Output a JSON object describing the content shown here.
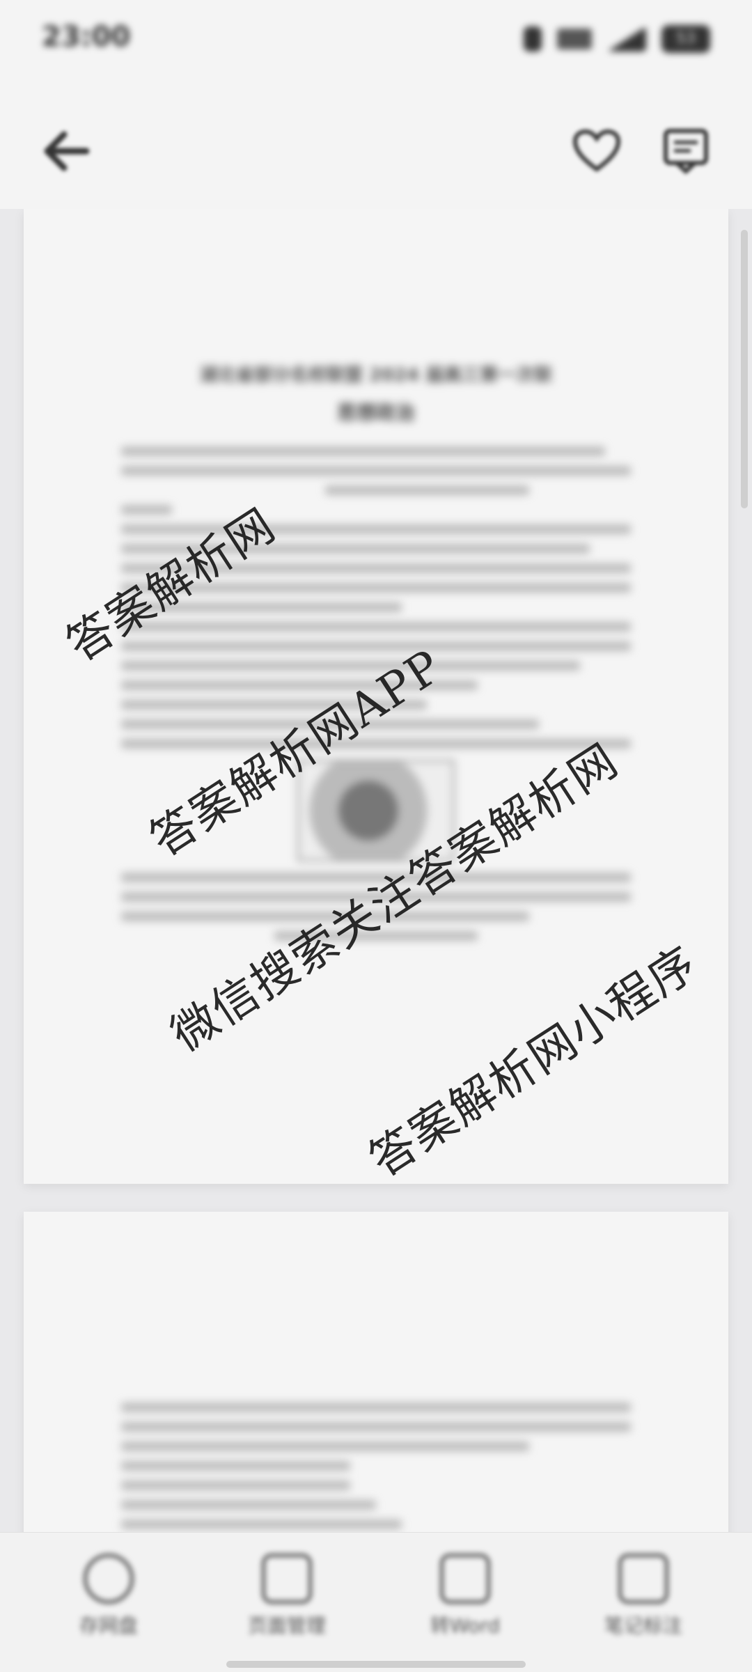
{
  "status_bar": {
    "time": "23:00",
    "battery": "53"
  },
  "toolbar": {
    "back_icon": "arrow-left-icon",
    "favorite_icon": "heart-icon",
    "comment_icon": "comment-icon"
  },
  "document": {
    "page1_title": "湖北省部分名校联盟 2024 届高三第一次联",
    "page1_subtitle": "思想政治"
  },
  "watermarks": {
    "w1": "答案解析网",
    "w2": "答案解析网APP",
    "w3": "微信搜索关注答案解析网",
    "w4": "答案解析网小程序"
  },
  "bottom_bar": {
    "items": [
      {
        "label": "存网盘",
        "icon": "cloud-icon"
      },
      {
        "label": "页面管理",
        "icon": "page-manage-icon"
      },
      {
        "label": "转Word",
        "icon": "convert-icon"
      },
      {
        "label": "笔记标注",
        "icon": "edit-icon"
      }
    ]
  },
  "colors": {
    "background": "#eeeef0",
    "page": "#f5f5f5",
    "text": "#222222"
  }
}
